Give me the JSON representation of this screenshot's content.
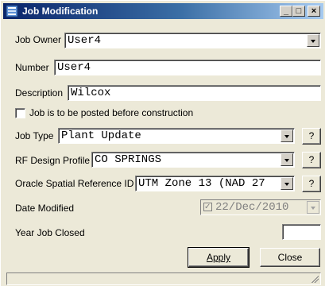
{
  "window": {
    "title": "Job Modification",
    "minimize_glyph": "_",
    "maximize_glyph": "□",
    "close_glyph": "×"
  },
  "form": {
    "job_owner_label": "Job Owner",
    "job_owner_value": "User4",
    "number_label": "Number",
    "number_value": "User4",
    "description_label": "Description",
    "description_value": "Wilcox",
    "posted_checkbox_label": "Job is to be posted before construction",
    "posted_checked": false,
    "job_type_label": "Job Type",
    "job_type_value": "Plant Update",
    "rf_design_label": "RF Design Profile",
    "rf_design_value": "CO SPRINGS",
    "oracle_srid_label": "Oracle Spatial Reference ID",
    "oracle_srid_value": "UTM Zone 13 (NAD 27",
    "help_button_label": "?",
    "date_modified_label": "Date Modified",
    "date_modified_value": "22/Dec/2010",
    "year_closed_label": "Year Job Closed",
    "year_closed_value": ""
  },
  "buttons": {
    "apply_label": "Apply",
    "close_label": "Close"
  },
  "icons": {
    "title_icon": "job-window-icon",
    "dropdown_arrow": "chevron-down-icon",
    "resize_grip": "resize-grip-icon"
  },
  "colors": {
    "titlebar_start": "#0a246a",
    "titlebar_end": "#a6caf0",
    "dialog_bg": "#ece9d8"
  }
}
